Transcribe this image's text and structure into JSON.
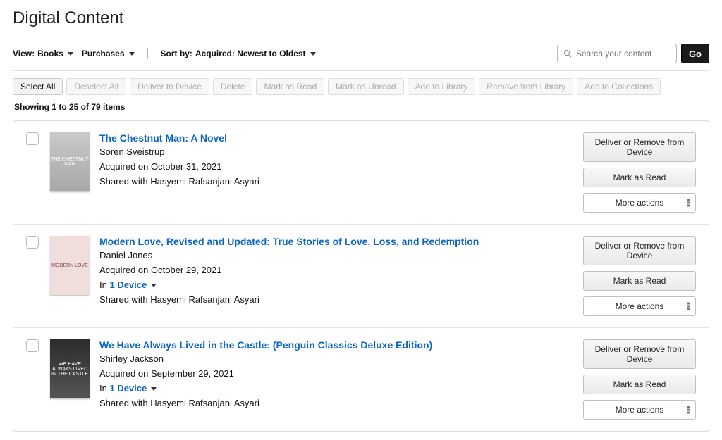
{
  "page_title": "Digital Content",
  "filters": {
    "view_label": "View:",
    "view_value_1": "Books",
    "view_value_2": "Purchases",
    "sort_label": "Sort by:",
    "sort_value": "Acquired: Newest to Oldest"
  },
  "search": {
    "placeholder": "Search your content",
    "go_label": "Go"
  },
  "bulk_actions": {
    "select_all": "Select All",
    "deselect_all": "Deselect All",
    "deliver": "Deliver to Device",
    "delete": "Delete",
    "mark_read": "Mark as Read",
    "mark_unread": "Mark as Unread",
    "add_library": "Add to Library",
    "remove_library": "Remove from Library",
    "add_collections": "Add to Collections"
  },
  "showing": "Showing 1 to 25 of 79 items",
  "row_action_labels": {
    "deliver": "Deliver or Remove from Device",
    "mark_read": "Mark as Read",
    "more": "More actions"
  },
  "items": [
    {
      "title": "The Chestnut Man: A Novel",
      "author": "Soren Sveistrup",
      "acquired": "Acquired on October 31, 2021",
      "devices_prefix": "",
      "devices_link": "",
      "shared": "Shared with Hasyemi Rafsanjani Asyari",
      "cover_label": "THE CHESTNUT MAN"
    },
    {
      "title": "Modern Love, Revised and Updated: True Stories of Love, Loss, and Redemption",
      "author": "Daniel Jones",
      "acquired": "Acquired on October 29, 2021",
      "devices_prefix": "In ",
      "devices_link": "1 Device",
      "shared": "Shared with Hasyemi Rafsanjani Asyari",
      "cover_label": "MODERN LOVE"
    },
    {
      "title": "We Have Always Lived in the Castle: (Penguin Classics Deluxe Edition)",
      "author": "Shirley Jackson",
      "acquired": "Acquired on September 29, 2021",
      "devices_prefix": "In ",
      "devices_link": "1 Device",
      "shared": "Shared with Hasyemi Rafsanjani Asyari",
      "cover_label": "WE HAVE ALWAYS LIVED IN THE CASTLE"
    }
  ]
}
